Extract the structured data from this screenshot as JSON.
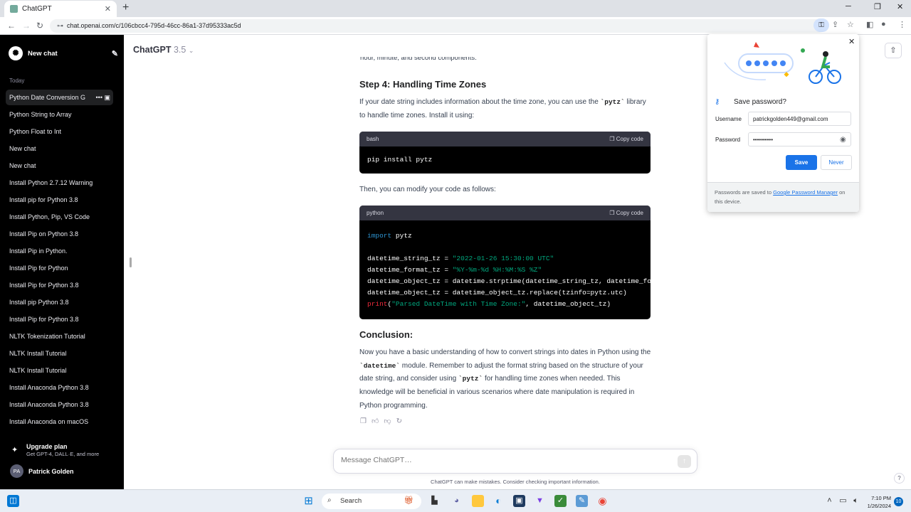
{
  "browser": {
    "tab_title": "ChatGPT",
    "new_tab": "+",
    "url": "chat.openai.com/c/106cbcc4-795d-46cc-86a1-37d95333ac5d"
  },
  "sidebar": {
    "new_chat": "New chat",
    "today_label": "Today",
    "items": [
      "Python Date Conversion G",
      "Python String to Array",
      "Python Float to Int",
      "New chat",
      "New chat",
      "Install Python 2.7.12 Warning",
      "Install pip for Python 3.8",
      "Install Python, Pip, VS Code",
      "Install Pip on Python 3.8",
      "Install Pip in Python.",
      "Install Pip for Python",
      "Install Pip for Python 3.8",
      "Install pip Python 3.8",
      "Install Pip for Python 3.8",
      "NLTK Tokenization Tutorial",
      "NLTK Install Tutorial",
      "NLTK Install Tutorial",
      "Install Anaconda Python 3.8",
      "Install Anaconda Python 3.8",
      "Install Anaconda on macOS"
    ],
    "upgrade_title": "Upgrade plan",
    "upgrade_sub": "Get GPT-4, DALL·E, and more",
    "user_initials": "PA",
    "user_name": "Patrick Golden"
  },
  "header": {
    "model": "ChatGPT",
    "version": "3.5"
  },
  "content": {
    "cut_text": "hour, minute, and second components.",
    "step4_title": "Step 4: Handling Time Zones",
    "step4_p1": "If your date string includes information about the time zone, you can use the",
    "step4_code": "`pytz`",
    "step4_p2": "library to handle time zones. Install it using:",
    "block1_lang": "bash",
    "copy_label": "Copy code",
    "block1_code": "pip install pytz",
    "then_text": "Then, you can modify your code as follows:",
    "block2_lang": "python",
    "block2_lines": {
      "l1_kw": "import",
      "l1_rest": " pytz",
      "l2_a": "datetime_string_tz = ",
      "l2_s": "\"2022-01-26 15:30:00 UTC\"",
      "l3_a": "datetime_format_tz = ",
      "l3_s": "\"%Y-%m-%d %H:%M:%S %Z\"",
      "l4": "datetime_object_tz = datetime.strptime(datetime_string_tz, datetime_for",
      "l5": "datetime_object_tz = datetime_object_tz.replace(tzinfo=pytz.utc)",
      "l6_fn": "print",
      "l6_s": "\"Parsed DateTime with Time Zone:\"",
      "l6_rest": ", datetime_object_tz)"
    },
    "conclusion_title": "Conclusion:",
    "conc_a": "Now you have a basic understanding of how to convert strings into dates in Python using the",
    "conc_code1": "`datetime`",
    "conc_b": "module. Remember to adjust the format string based on the structure of your date string, and consider using",
    "conc_code2": "`pytz`",
    "conc_c": "for handling time zones when needed. This knowledge will be beneficial in various scenarios where date manipulation is required in Python programming."
  },
  "composer": {
    "placeholder": "Message ChatGPT…",
    "disclaimer": "ChatGPT can make mistakes. Consider checking important information."
  },
  "password_popup": {
    "title": "Save password?",
    "username_label": "Username",
    "username_value": "patrickgolden449@gmail.com",
    "password_label": "Password",
    "password_value": "••••••••••",
    "save": "Save",
    "never": "Never",
    "footer_a": "Passwords are saved to",
    "footer_link": "Google Password Manager",
    "footer_b": "on this device."
  },
  "taskbar": {
    "search": "Search",
    "time": "7:10 PM",
    "date": "1/26/2024",
    "notifications": "10"
  }
}
